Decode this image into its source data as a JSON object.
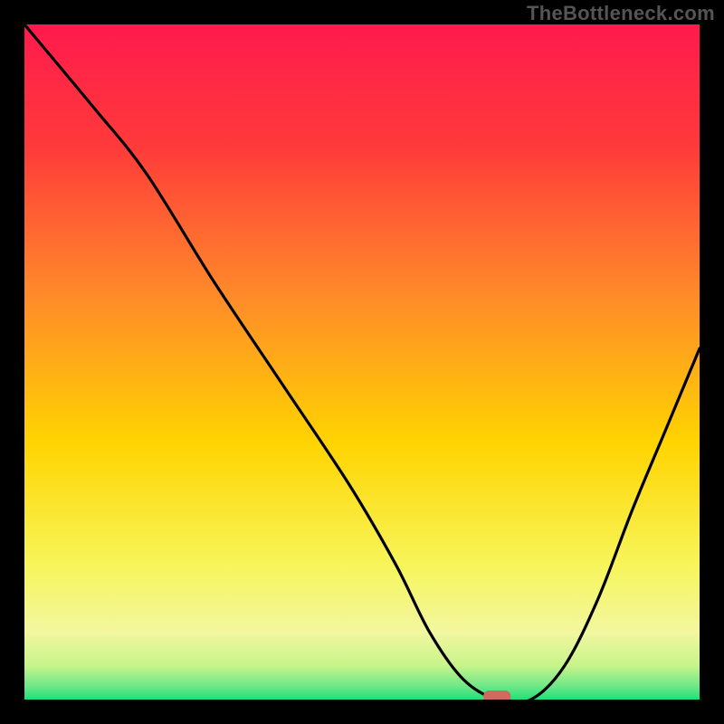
{
  "watermark": "TheBottleneck.com",
  "colors": {
    "frame_bg": "#000000",
    "gradient_top": "#ff1a4d",
    "gradient_mid1": "#ff7a2a",
    "gradient_mid2": "#ffd400",
    "gradient_mid3": "#f8f66a",
    "gradient_bottom": "#1fe07a",
    "curve": "#000000",
    "marker": "#cf6a5e",
    "watermark_text": "#555555"
  },
  "chart_data": {
    "type": "line",
    "title": "",
    "xlabel": "",
    "ylabel": "",
    "xlim": [
      0,
      100
    ],
    "ylim": [
      0,
      100
    ],
    "grid": false,
    "legend": false,
    "series": [
      {
        "name": "bottleneck-curve",
        "x": [
          0,
          10,
          18,
          28,
          38,
          48,
          55,
          60,
          65,
          70,
          75,
          80,
          85,
          90,
          95,
          100
        ],
        "y": [
          100,
          88,
          78,
          62,
          47,
          32,
          20,
          10,
          3,
          0,
          0,
          5,
          15,
          28,
          40,
          52
        ]
      }
    ],
    "annotations": [
      {
        "name": "optimal-marker",
        "x": 70,
        "y": 0,
        "shape": "rounded-rect"
      }
    ]
  }
}
